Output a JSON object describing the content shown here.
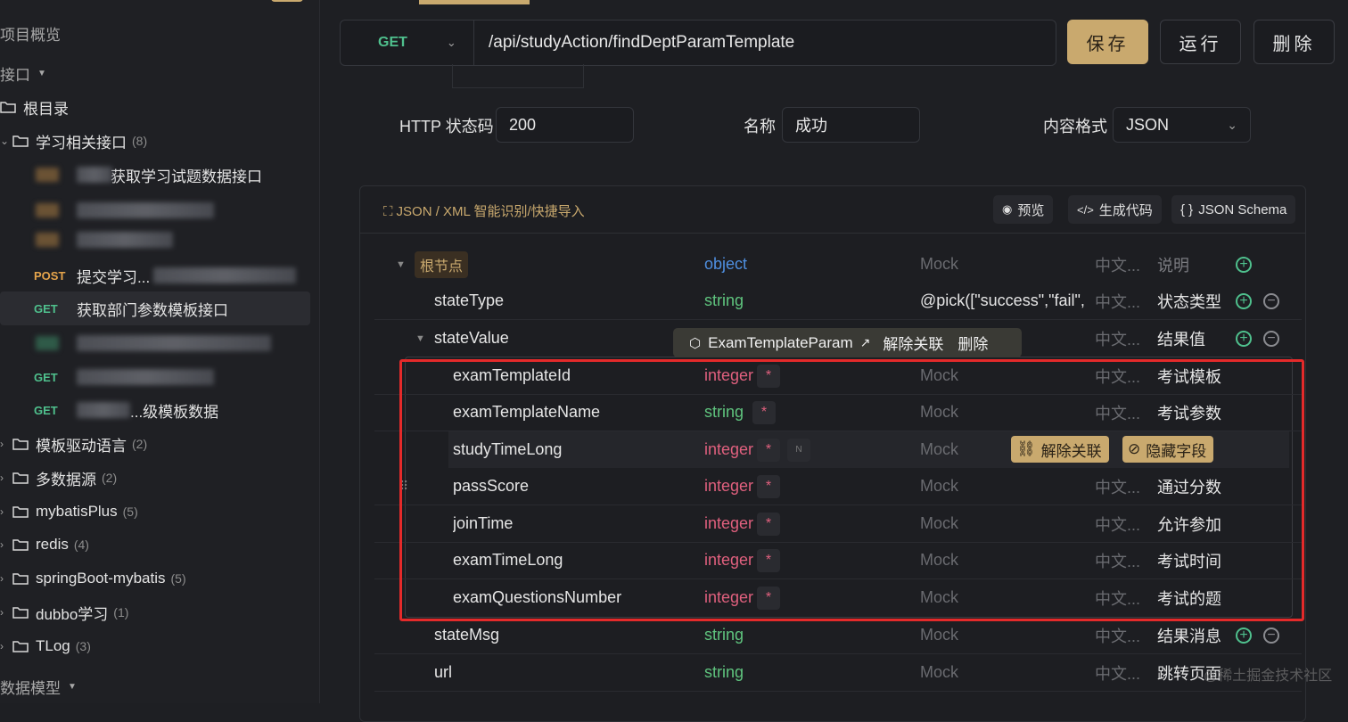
{
  "sidebar": {
    "overview": "项目概览",
    "api_section": "接口",
    "root": "根目录",
    "folders": [
      {
        "name": "学习相关接口",
        "count": "(8)"
      },
      {
        "name": "模板驱动语言",
        "count": "(2)"
      },
      {
        "name": "多数据源",
        "count": "(2)"
      },
      {
        "name": "mybatisPlus",
        "count": "(5)"
      },
      {
        "name": "redis",
        "count": "(4)"
      },
      {
        "name": "springBoot-mybatis",
        "count": "(5)"
      },
      {
        "name": "dubbo学习",
        "count": "(1)"
      },
      {
        "name": "TLog",
        "count": "(3)"
      }
    ],
    "items": [
      {
        "method": "",
        "label": "获取学习试题数据接口"
      },
      {
        "method": "POST",
        "label": "提交学习..."
      },
      {
        "method": "GET",
        "label": "获取部门参数模板接口"
      },
      {
        "method": "GET",
        "label": ""
      },
      {
        "method": "GET",
        "label": "...级模板数据"
      }
    ],
    "data_models": "数据模型"
  },
  "request": {
    "method": "GET",
    "url": "/api/studyAction/findDeptParamTemplate",
    "save": "保存",
    "run": "运行",
    "delete": "删除"
  },
  "response": {
    "status_label": "HTTP 状态码",
    "status_value": "200",
    "name_label": "名称",
    "name_value": "成功",
    "format_label": "内容格式",
    "format_value": "JSON"
  },
  "panel": {
    "import_link": "JSON / XML 智能识别/快捷导入",
    "preview": "预览",
    "gen_code": "生成代码",
    "schema": "JSON Schema"
  },
  "ref_popover": {
    "model": "ExamTemplateParam",
    "unlink": "解除关联",
    "delete": "删除"
  },
  "row_actions": {
    "unlink": "解除关联",
    "hide": "隐藏字段"
  },
  "schema_rows": [
    {
      "name": "根节点",
      "type": "object",
      "mock": "Mock",
      "cn": "中文...",
      "desc": "说明"
    },
    {
      "name": "stateType",
      "type": "string",
      "mock": "@pick([\"success\",\"fail\",",
      "cn": "中文...",
      "desc": "状态类型"
    },
    {
      "name": "stateValue",
      "type": "",
      "mock": "",
      "cn": "中文...",
      "desc": "结果值"
    },
    {
      "name": "examTemplateId",
      "type": "integer",
      "mock": "Mock",
      "cn": "中文...",
      "desc": "考试模板"
    },
    {
      "name": "examTemplateName",
      "type": "string",
      "mock": "Mock",
      "cn": "中文...",
      "desc": "考试参数"
    },
    {
      "name": "studyTimeLong",
      "type": "integer",
      "mock": "Mock",
      "cn": "",
      "desc": ""
    },
    {
      "name": "passScore",
      "type": "integer",
      "mock": "Mock",
      "cn": "中文...",
      "desc": "通过分数"
    },
    {
      "name": "joinTime",
      "type": "integer",
      "mock": "Mock",
      "cn": "中文...",
      "desc": "允许参加"
    },
    {
      "name": "examTimeLong",
      "type": "integer",
      "mock": "Mock",
      "cn": "中文...",
      "desc": "考试时间"
    },
    {
      "name": "examQuestionsNumber",
      "type": "integer",
      "mock": "Mock",
      "cn": "中文...",
      "desc": "考试的题"
    },
    {
      "name": "stateMsg",
      "type": "string",
      "mock": "Mock",
      "cn": "中文...",
      "desc": "结果消息"
    },
    {
      "name": "url",
      "type": "string",
      "mock": "Mock",
      "cn": "中文...",
      "desc": "跳转页面"
    }
  ],
  "required_mark": "*",
  "n_badge": "N",
  "watermark": "@稀土掘金技术社区",
  "colors": {
    "accent": "#c9a96e",
    "get": "#4fc08d",
    "post": "#e5a44b",
    "integer": "#e0607e",
    "string": "#5fc47e",
    "object": "#4f8fe0",
    "highlight": "#e42a2a"
  }
}
